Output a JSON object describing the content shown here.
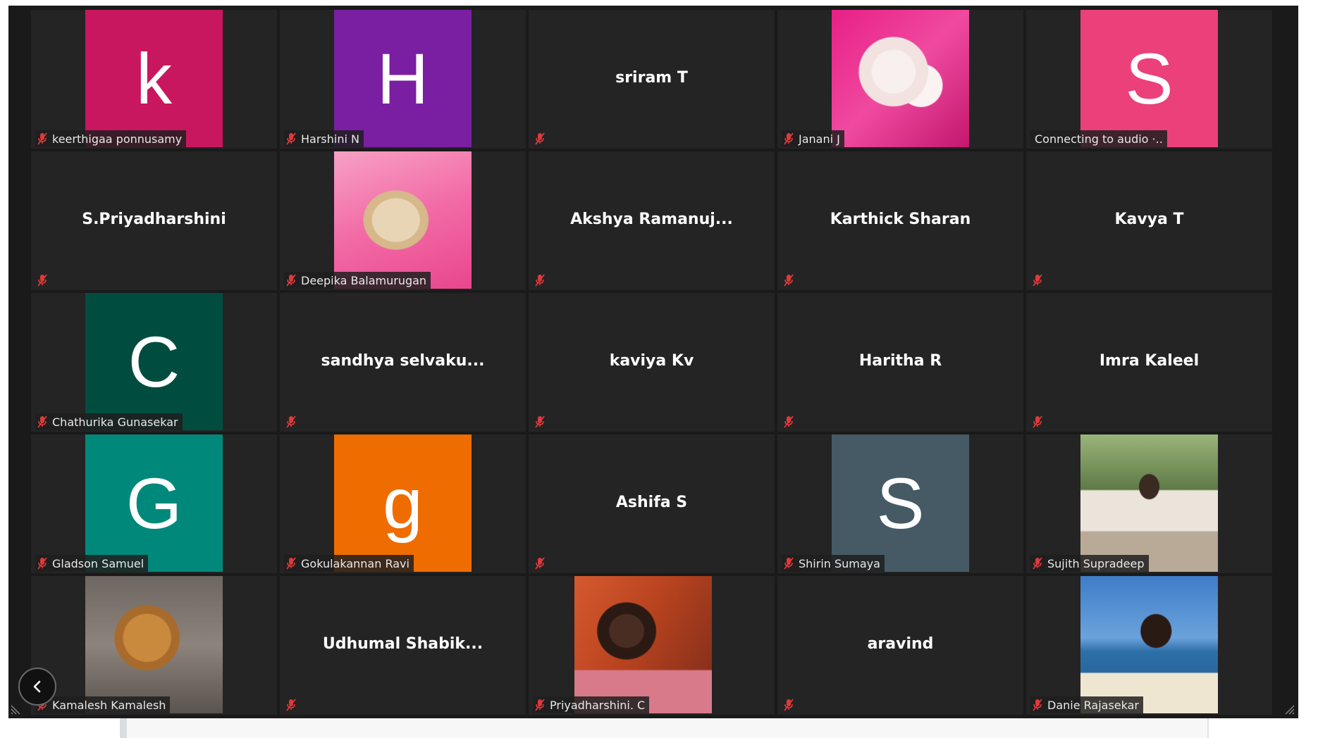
{
  "colors": {
    "window_bg": "#1a1a1a",
    "tile_bg": "#242424",
    "mic_muted": "#e0393a",
    "avatar_k": "#c8175e",
    "avatar_H": "#7b1fa2",
    "avatar_S1": "#ec407a",
    "avatar_C": "#004d40",
    "avatar_G": "#00897b",
    "avatar_g": "#ef6c00",
    "avatar_S2": "#455a64"
  },
  "participants": [
    {
      "label": "keerthigaa ponnusamy",
      "avatar_letter": "k",
      "avatar_color": "#c8175e",
      "muted": true
    },
    {
      "label": "Harshini N",
      "avatar_letter": "H",
      "avatar_color": "#7b1fa2",
      "muted": true
    },
    {
      "center_name": "sriram T",
      "muted": true
    },
    {
      "label": "Janani J",
      "photo": "teddy-bears-photo",
      "muted": true
    },
    {
      "label": "Connecting to audio ·..",
      "avatar_letter": "S",
      "avatar_color": "#ec407a",
      "muted": false
    },
    {
      "center_name": "S.Priyadharshini",
      "muted": true
    },
    {
      "label": "Deepika Balamurugan",
      "photo": "puppy-photo",
      "muted": true
    },
    {
      "center_name": "Akshya  Ramanuj...",
      "muted": true
    },
    {
      "center_name": "Karthick Sharan",
      "muted": true
    },
    {
      "center_name": "Kavya T",
      "muted": true
    },
    {
      "label": "Chathurika Gunasekar",
      "avatar_letter": "C",
      "avatar_color": "#004d40",
      "muted": true
    },
    {
      "center_name": "sandhya  selvaku...",
      "muted": true
    },
    {
      "center_name": "kaviya Kv",
      "muted": true
    },
    {
      "center_name": "Haritha R",
      "muted": true
    },
    {
      "center_name": "Imra Kaleel",
      "muted": true
    },
    {
      "label": "Gladson Samuel",
      "avatar_letter": "G",
      "avatar_color": "#00897b",
      "muted": true
    },
    {
      "label": "Gokulakannan Ravi",
      "avatar_letter": "g",
      "avatar_color": "#ef6c00",
      "muted": true
    },
    {
      "center_name": "Ashifa S",
      "muted": true
    },
    {
      "label": "Shirin Sumaya",
      "avatar_letter": "S",
      "avatar_color": "#455a64",
      "muted": true
    },
    {
      "label": "Sujith Supradeep",
      "photo": "boy-outdoor-photo",
      "muted": true
    },
    {
      "label": "Kamalesh Kamalesh",
      "photo": "lion-cub-photo",
      "muted": true
    },
    {
      "center_name": "Udhumal  Shabik...",
      "muted": true
    },
    {
      "label": "Priyadharshini. C",
      "photo": "girl-photo",
      "muted": true
    },
    {
      "center_name": "aravind",
      "muted": true
    },
    {
      "label": "Danie Rajasekar",
      "photo": "boy-beach-photo",
      "muted": true
    }
  ],
  "controls": {
    "prev_page_icon": "chevron-left-icon",
    "resize_icon": "resize-grip-icon"
  }
}
